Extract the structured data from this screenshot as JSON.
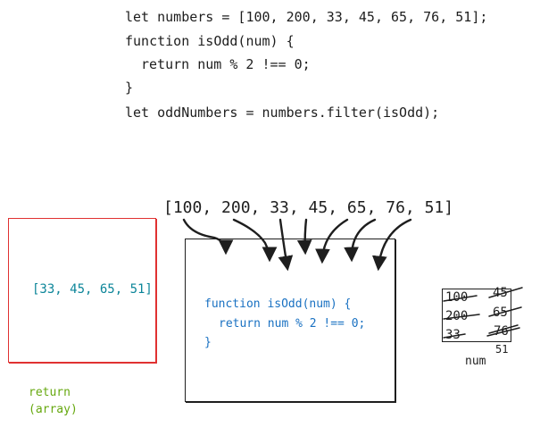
{
  "code": {
    "line1": "let numbers = [100, 200, 33, 45, 65, 76, 51];",
    "line2": "function isOdd(num) {",
    "line3": "return num % 2 !== 0;",
    "line4": "}",
    "line5": "let oddNumbers = numbers.filter(isOdd);"
  },
  "input_array": "[100, 200, 33, 45, 65, 76, 51]",
  "function_box": {
    "line1": "function isOdd(num) {",
    "line2": "return num % 2 !== 0;",
    "line3": "}"
  },
  "result": {
    "array": "[33, 45, 65, 51]",
    "label_line1": "return",
    "label_line2": "(array)"
  },
  "num_box": {
    "label": "num",
    "values": [
      "100",
      "45",
      "200",
      "65",
      "33",
      "76",
      "51"
    ]
  },
  "colors": {
    "ink": "#1e1e1e",
    "result_box": "#e03131",
    "result_text": "#0c8599",
    "function_text": "#1971c2",
    "return_label": "#66a80f"
  }
}
